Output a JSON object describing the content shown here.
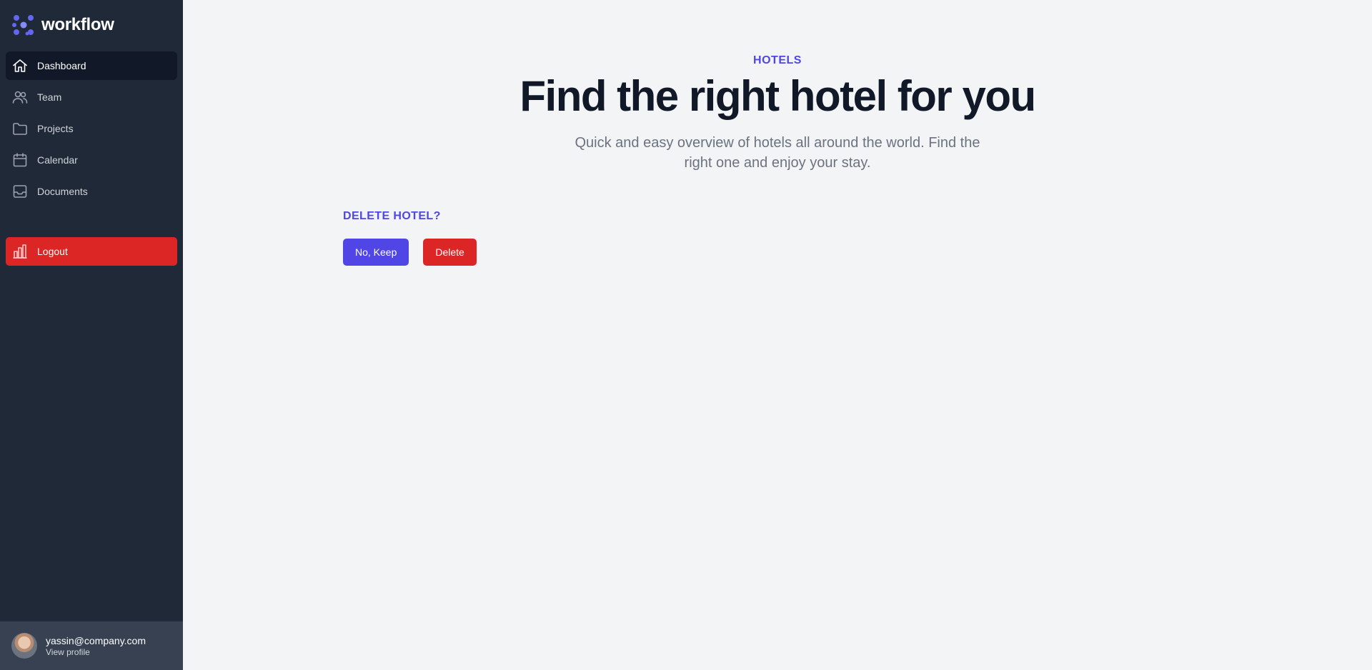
{
  "brand": {
    "name": "workflow",
    "logo_icon": "workflow-logo-icon",
    "accent": "#6366f1"
  },
  "sidebar": {
    "items": [
      {
        "label": "Dashboard",
        "icon": "home-icon",
        "active": true
      },
      {
        "label": "Team",
        "icon": "users-icon",
        "active": false
      },
      {
        "label": "Projects",
        "icon": "folder-icon",
        "active": false
      },
      {
        "label": "Calendar",
        "icon": "calendar-icon",
        "active": false
      },
      {
        "label": "Documents",
        "icon": "inbox-icon",
        "active": false
      }
    ],
    "logout": {
      "label": "Logout",
      "icon": "chart-bar-icon",
      "color": "#dc2626"
    }
  },
  "profile": {
    "email": "yassin@company.com",
    "link": "View profile"
  },
  "hero": {
    "eyebrow": "Hotels",
    "headline": "Find the right hotel for you",
    "subtitle": "Quick and easy overview of hotels all around the world. Find the right one and enjoy your stay."
  },
  "confirm": {
    "title": "Delete hotel?",
    "keep_label": "No, Keep",
    "delete_label": "Delete",
    "keep_color": "#4f46e5",
    "delete_color": "#dc2626"
  }
}
